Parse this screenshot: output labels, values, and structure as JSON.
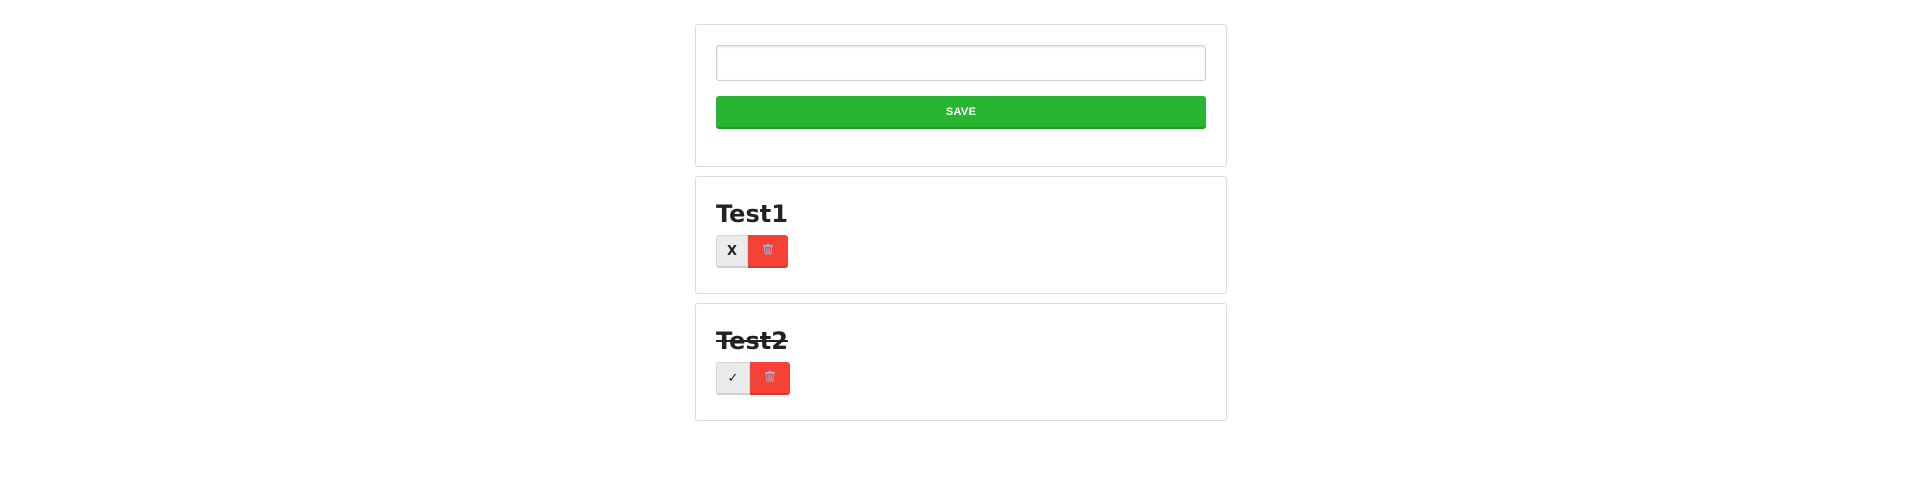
{
  "form": {
    "input_value": "",
    "input_placeholder": "",
    "save_label": "SAVE"
  },
  "todos": [
    {
      "title": "Test1",
      "done": false,
      "toggle_label": "X",
      "delete_icon": "trash-icon"
    },
    {
      "title": "Test2",
      "done": true,
      "toggle_label": "✓",
      "delete_icon": "trash-icon"
    }
  ],
  "colors": {
    "save": "#28b531",
    "delete": "#f44336",
    "toggle": "#ebebeb"
  }
}
